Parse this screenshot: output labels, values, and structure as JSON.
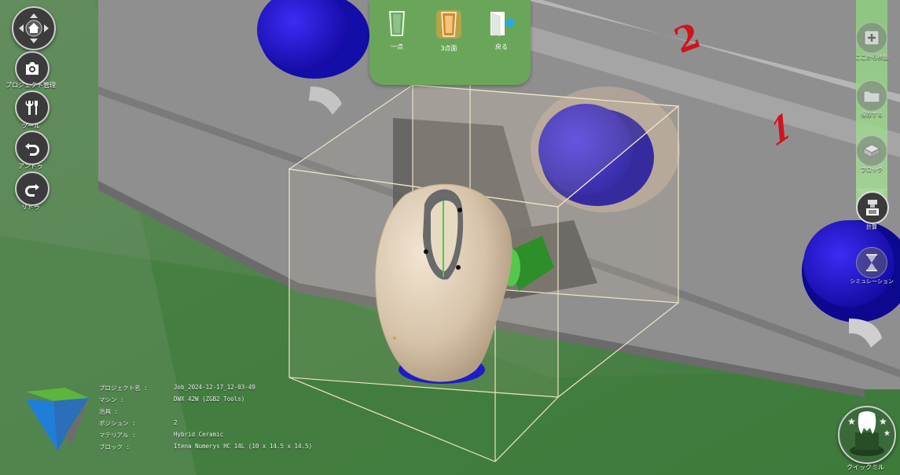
{
  "left_toolbar": {
    "items": [
      {
        "icon": "home-nav-icon",
        "label": ""
      },
      {
        "icon": "camera-icon",
        "label": "プロジェクト管理"
      },
      {
        "icon": "tools-icon",
        "label": "ツール"
      },
      {
        "icon": "undo-icon",
        "label": "アンドゥ"
      },
      {
        "icon": "redo-icon",
        "label": "リドゥ"
      }
    ]
  },
  "top_toolbar": {
    "items": [
      {
        "icon": "one-point-icon",
        "label": "一点",
        "active": false
      },
      {
        "icon": "three-point-icon",
        "label": "3点面",
        "active": true
      },
      {
        "icon": "exit-door-icon",
        "label": "戻る",
        "active": false
      }
    ]
  },
  "right_toolbar": {
    "items": [
      {
        "icon": "add-here-icon",
        "label": "ここから移動"
      },
      {
        "icon": "folder-icon",
        "label": "保存する"
      },
      {
        "icon": "block-icon",
        "label": "ブロック"
      },
      {
        "icon": "calculate-icon",
        "label": "計算"
      },
      {
        "icon": "simulation-icon",
        "label": "シミュレーション"
      }
    ]
  },
  "viewport": {
    "fixture_numbers": [
      "2",
      "1"
    ]
  },
  "project_info": {
    "rows": [
      {
        "key": "プロジェクト名 :",
        "value": "Job_2024-12-17_12-03-49"
      },
      {
        "key": "マシン :",
        "value": "DWX 42W (ZGB2 Tools)"
      },
      {
        "key": "治具 :",
        "value": ""
      },
      {
        "key": "ポジション :",
        "value": "2"
      },
      {
        "key": "マテリアル :",
        "value": "Hybrid Ceramic"
      },
      {
        "key": "ブロック :",
        "value": "Itena Numerys HC 14L (10 x 14.5 x 14.5)"
      }
    ]
  },
  "quick_mill": {
    "label": "クイックミル"
  },
  "colors": {
    "accent_green": "#6aa65a",
    "fixture_blue": "#1a10d8",
    "tooth_beige": "#d8c7ae",
    "bottom_bar_green": "#5f8f5f"
  }
}
